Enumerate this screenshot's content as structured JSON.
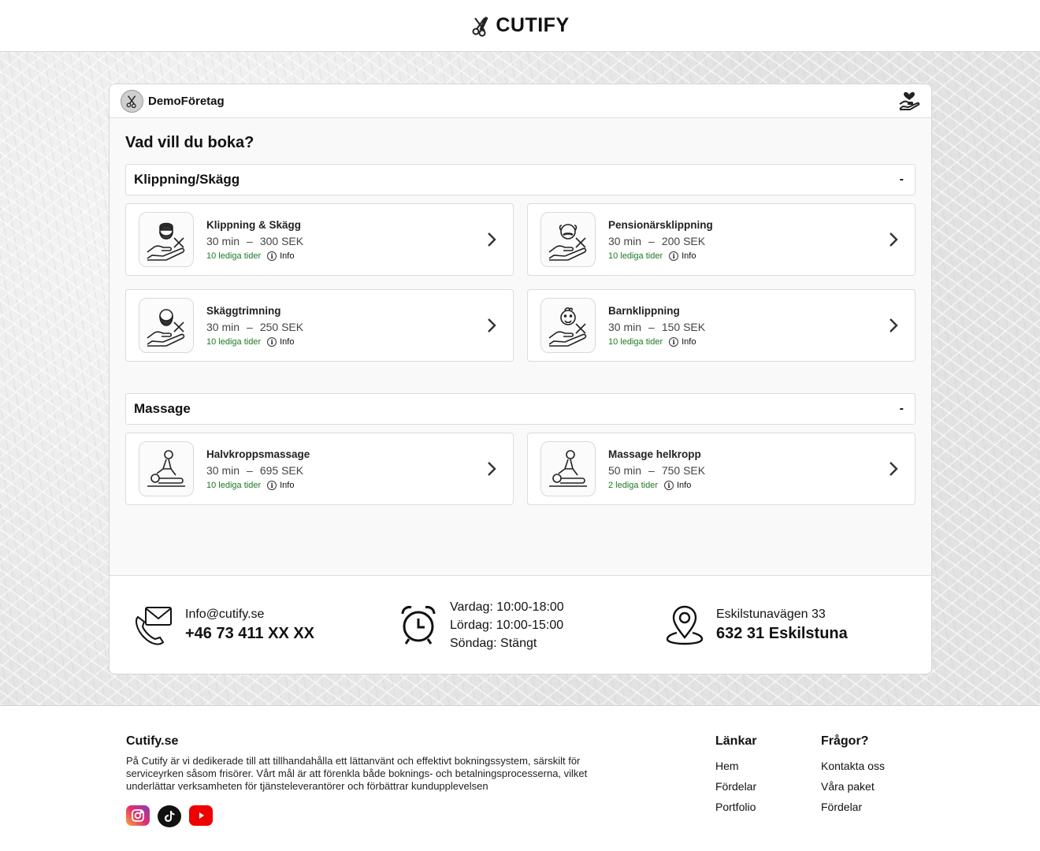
{
  "brand": {
    "name": "CUTIFY"
  },
  "card": {
    "company_name": "DemoFöretag",
    "question": "Vad vill du boka?",
    "categories": [
      {
        "name": "Klippning/Skägg",
        "toggle": "-",
        "services": [
          {
            "name": "Klippning & Skägg",
            "duration": "30 min",
            "dash": "–",
            "price": "300 SEK",
            "availability": "10 lediga tider",
            "info": "Info",
            "icon": "man-beard-haircut-icon"
          },
          {
            "name": "Pensionärsklippning",
            "duration": "30 min",
            "dash": "–",
            "price": "200 SEK",
            "availability": "10 lediga tider",
            "info": "Info",
            "icon": "senior-haircut-icon"
          },
          {
            "name": "Skäggtrimning",
            "duration": "30 min",
            "dash": "–",
            "price": "250 SEK",
            "availability": "10 lediga tider",
            "info": "Info",
            "icon": "beard-trim-icon"
          },
          {
            "name": "Barnklippning",
            "duration": "30 min",
            "dash": "–",
            "price": "150 SEK",
            "availability": "10 lediga tider",
            "info": "Info",
            "icon": "child-haircut-icon"
          }
        ]
      },
      {
        "name": "Massage",
        "toggle": "-",
        "services": [
          {
            "name": "Halvkroppsmassage",
            "duration": "30 min",
            "dash": "–",
            "price": "695 SEK",
            "availability": "10 lediga tider",
            "info": "Info",
            "icon": "massage-icon"
          },
          {
            "name": "Massage helkropp",
            "duration": "50 min",
            "dash": "–",
            "price": "750 SEK",
            "availability": "2 lediga tider",
            "info": "Info",
            "icon": "massage-icon"
          }
        ]
      }
    ],
    "contact": {
      "email": "Info@cutify.se",
      "phone": "+46 73 411 XX XX",
      "hours": [
        "Vardag: 10:00-18:00",
        "Lördag: 10:00-15:00",
        "Söndag: Stängt"
      ],
      "street": "Eskilstunavägen 33",
      "city": "632 31 Eskilstuna"
    }
  },
  "footer": {
    "title": "Cutify.se",
    "text": "På Cutify är vi dedikerade till att tillhandahålla ett lättanvänt och effektivt bokningssystem, särskilt för serviceyrken såsom frisörer. Vårt mål är att förenkla både boknings- och betalningsprocesserna, vilket underlättar verksamheten för tjänsteleverantörer och förbättrar kundupplevelsen",
    "links_title": "Länkar",
    "links": [
      "Hem",
      "Fördelar",
      "Portfolio"
    ],
    "faq_title": "Frågor?",
    "faq": [
      "Kontakta oss",
      "Våra paket",
      "Fördelar"
    ]
  },
  "colors": {
    "availability": "#1d7a22",
    "instagram": "#e1306c",
    "youtube": "#ee0000"
  }
}
